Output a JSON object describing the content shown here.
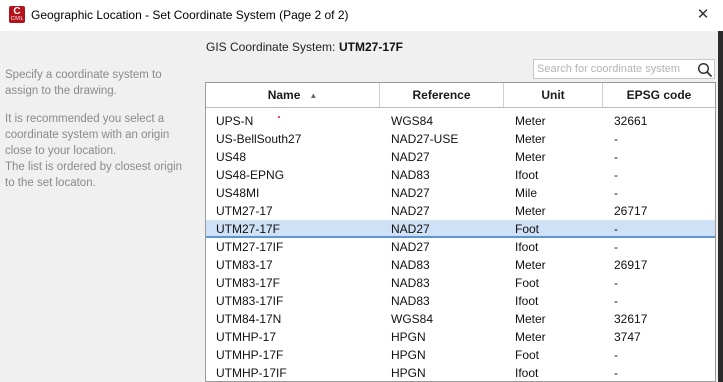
{
  "window": {
    "title": "Geographic Location - Set Coordinate System (Page 2 of 2)",
    "app_icon": {
      "letter": "C",
      "sub": "CIVIL",
      "color": "#b5121b"
    },
    "close_glyph": "✕"
  },
  "sidebar": {
    "lines": [
      "Specify a coordinate system to",
      "assign to the drawing.",
      "It is recommended you select a",
      "coordinate system with an origin",
      "close to your location.",
      "The list is ordered by closest origin",
      "to the set locaton."
    ]
  },
  "gis": {
    "label": "GIS Coordinate System:",
    "value": "UTM27-17F"
  },
  "search": {
    "placeholder": "Search for coordinate system",
    "value": "",
    "icon": "search-icon"
  },
  "table": {
    "columns": [
      {
        "label": "Name",
        "sort": "▲"
      },
      {
        "label": "Reference"
      },
      {
        "label": "Unit"
      },
      {
        "label": "EPSG code"
      }
    ],
    "selected_index": 6,
    "selection_color": "#cfe1f6",
    "rows": [
      {
        "name": "UPS-N",
        "reference": "WGS84",
        "unit": "Meter",
        "epsg": "32661"
      },
      {
        "name": "US-BellSouth27",
        "reference": "NAD27-USE",
        "unit": "Meter",
        "epsg": "-"
      },
      {
        "name": "US48",
        "reference": "NAD27",
        "unit": "Meter",
        "epsg": "-"
      },
      {
        "name": "US48-EPNG",
        "reference": "NAD83",
        "unit": "Ifoot",
        "epsg": "-"
      },
      {
        "name": "US48MI",
        "reference": "NAD27",
        "unit": "Mile",
        "epsg": "-"
      },
      {
        "name": "UTM27-17",
        "reference": "NAD27",
        "unit": "Meter",
        "epsg": "26717"
      },
      {
        "name": "UTM27-17F",
        "reference": "NAD27",
        "unit": "Foot",
        "epsg": "-"
      },
      {
        "name": "UTM27-17IF",
        "reference": "NAD27",
        "unit": "Ifoot",
        "epsg": "-"
      },
      {
        "name": "UTM83-17",
        "reference": "NAD83",
        "unit": "Meter",
        "epsg": "26917"
      },
      {
        "name": "UTM83-17F",
        "reference": "NAD83",
        "unit": "Foot",
        "epsg": "-"
      },
      {
        "name": "UTM83-17IF",
        "reference": "NAD83",
        "unit": "Ifoot",
        "epsg": "-"
      },
      {
        "name": "UTM84-17N",
        "reference": "WGS84",
        "unit": "Meter",
        "epsg": "32617"
      },
      {
        "name": "UTMHP-17",
        "reference": "HPGN",
        "unit": "Meter",
        "epsg": "3747"
      },
      {
        "name": "UTMHP-17F",
        "reference": "HPGN",
        "unit": "Foot",
        "epsg": "-"
      },
      {
        "name": "UTMHP-17IF",
        "reference": "HPGN",
        "unit": "Ifoot",
        "epsg": "-"
      }
    ]
  }
}
